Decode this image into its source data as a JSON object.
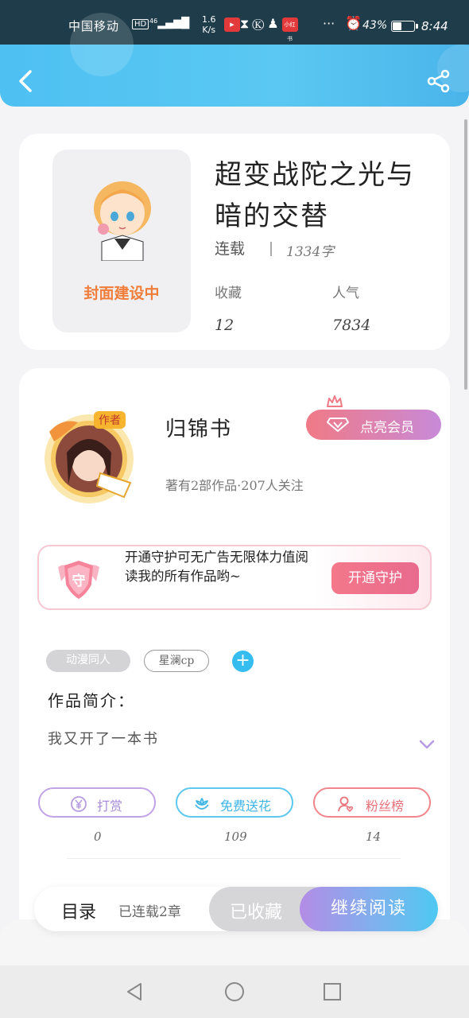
{
  "status_bar": {
    "carrier": "中国移动",
    "hd": "HD",
    "network": "46",
    "speed_value": "1.6",
    "speed_unit": "K/s",
    "app_badge": "小红书",
    "more": "···",
    "battery_pct": "43%",
    "battery_level": 0.43,
    "time": "8:44"
  },
  "header": {
    "back_icon": "chevron-left-icon",
    "share_icon": "share-icon",
    "color": "#4ec0f2"
  },
  "book": {
    "cover_label": "封面建设中",
    "title": "超变战陀之光与暗的交替",
    "status": "连载",
    "word_count": "1334字",
    "stats": {
      "favorites_label": "收藏",
      "favorites_value": "12",
      "popularity_label": "人气",
      "popularity_value": "7834"
    }
  },
  "author": {
    "avatar_badge": "作者",
    "name": "归锦书",
    "vip_button": "点亮会员",
    "meta": "著有2部作品·207人关注"
  },
  "guard": {
    "shield_char": "守",
    "text": "开通守护可无广告无限体力值阅读我的所有作品哟~",
    "button": "开通守护"
  },
  "tags": [
    "动漫同人",
    "星澜cp"
  ],
  "tag_add": "+",
  "intro": {
    "title": "作品简介：",
    "text": "我又开了一本书"
  },
  "actions": [
    {
      "label": "打赏",
      "count": "0",
      "icon": "yen-coin-icon",
      "color": "#a78bd6"
    },
    {
      "label": "免费送花",
      "count": "109",
      "icon": "flower-icon",
      "color": "#3fb5e6"
    },
    {
      "label": "粉丝榜",
      "count": "14",
      "icon": "user-heart-icon",
      "color": "#e8727a"
    }
  ],
  "bottom_bar": {
    "toc_label": "目录",
    "toc_status": "已连载2章",
    "collected": "已收藏",
    "read": "继续阅读"
  }
}
